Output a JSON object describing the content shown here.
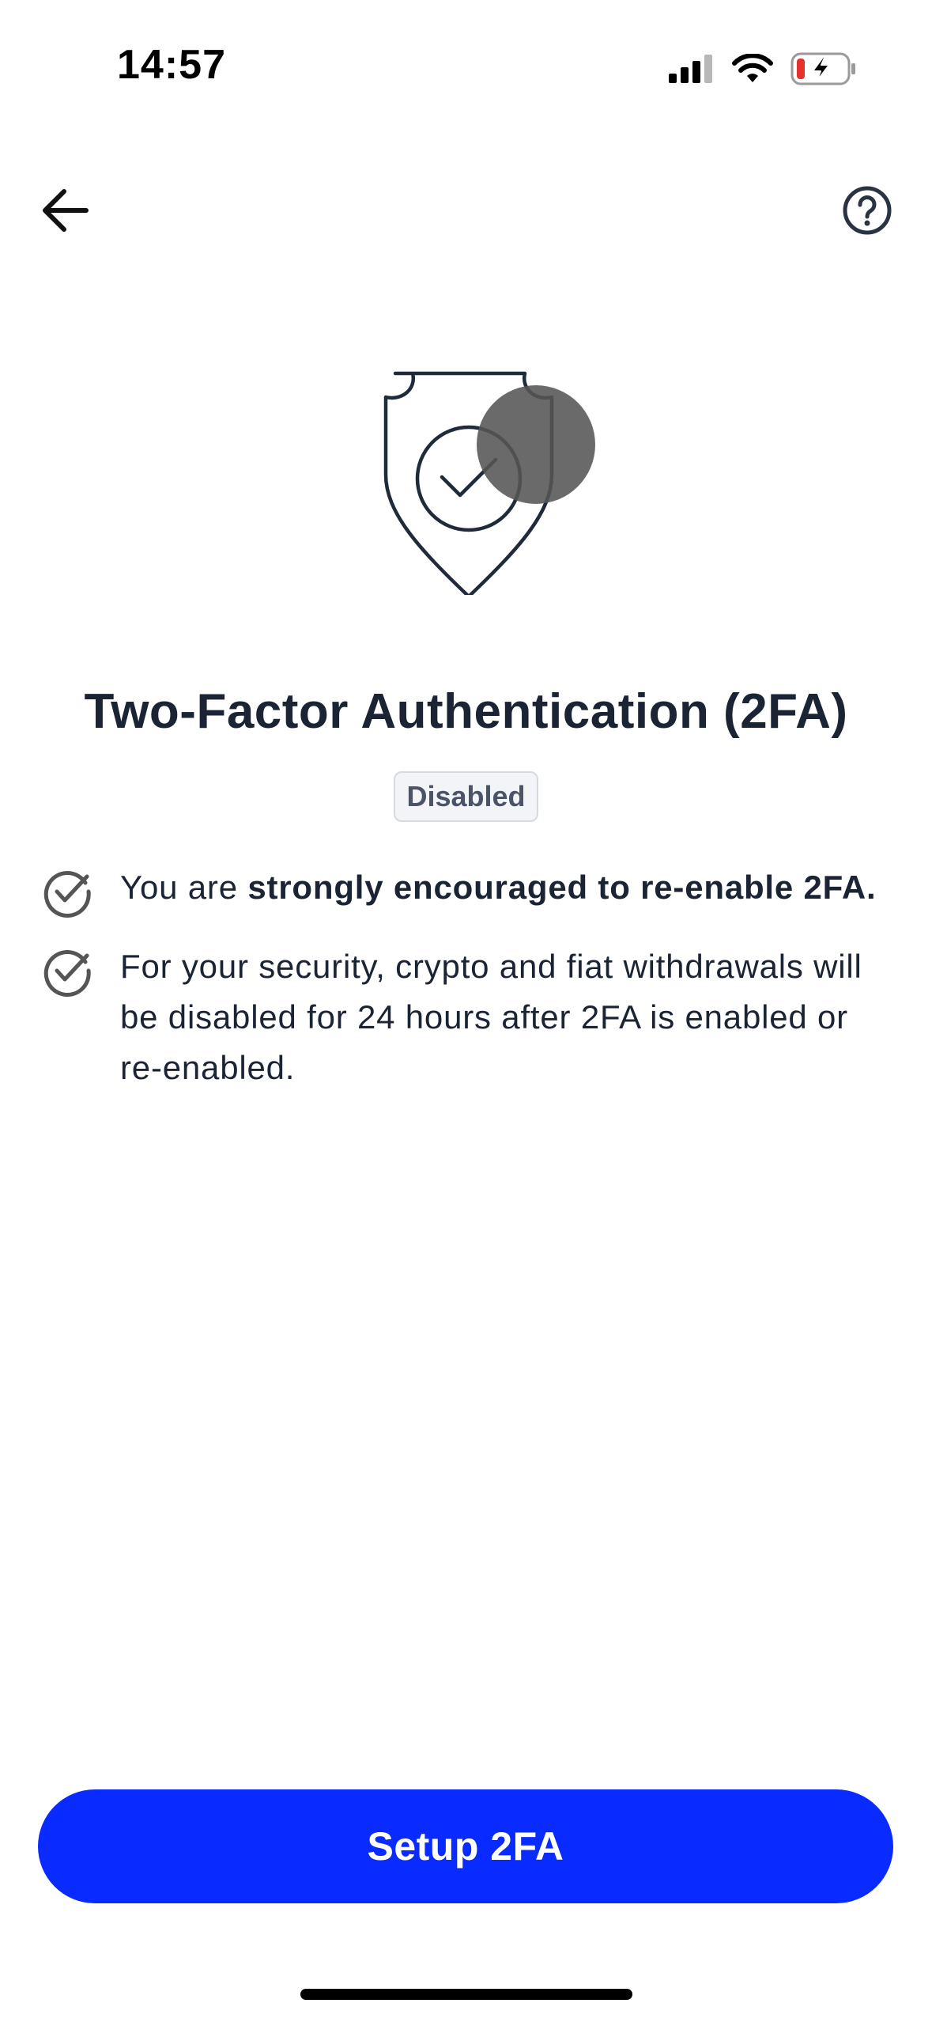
{
  "status_bar": {
    "time": "14:57",
    "icons": [
      "cellular-signal-icon",
      "wifi-icon",
      "battery-charging-icon"
    ]
  },
  "nav": {
    "back_icon": "arrow-left-icon",
    "help_icon": "question-circle-icon"
  },
  "hero_icon": "shield-check-icon",
  "title": "Two-Factor Authentication (2FA)",
  "status_badge": "Disabled",
  "info_items": [
    {
      "icon": "check-circle-icon",
      "text_prefix": "You are ",
      "text_bold": "strongly encouraged to re-enable 2FA."
    },
    {
      "icon": "check-circle-icon",
      "text": "For your security, crypto and fiat withdrawals will be disabled for 24 hours after 2FA is enabled or re-enabled."
    }
  ],
  "cta": {
    "label": "Setup 2FA"
  },
  "colors": {
    "primary": "#0a2bff",
    "text": "#1b2434",
    "badge_bg": "#f2f4f7",
    "badge_border": "#d5d9e0",
    "battery_low": "#e5322d"
  }
}
